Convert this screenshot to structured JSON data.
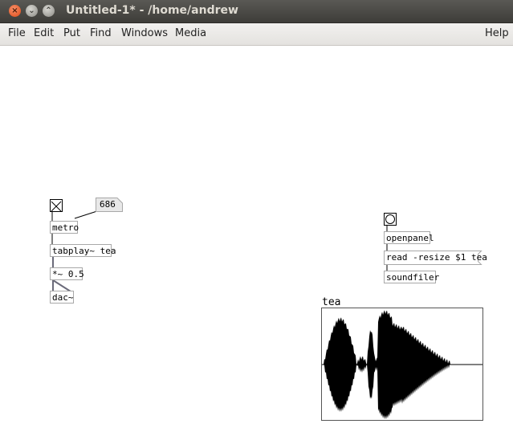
{
  "window": {
    "title": "Untitled-1* - /home/andrew",
    "close_glyph": "×",
    "min_glyph": "⌄",
    "max_glyph": "⌃"
  },
  "menubar": {
    "items": [
      "File",
      "Edit",
      "Put",
      "Find",
      "Windows",
      "Media"
    ],
    "help": "Help"
  },
  "patch": {
    "number_box_value": "686",
    "metro_label": "metro",
    "tabplay_label": "tabplay~ tea",
    "multiply_label": "*~ 0.5",
    "dac_label": "dac~",
    "openpanel_label": "openpanel",
    "read_message": "read -resize $1 tea",
    "soundfiler_label": "soundfiler",
    "array_name": "tea"
  },
  "colors": {
    "titlebar": "#3e3d39",
    "title_text": "#dfdbd2",
    "close_button": "#df4a16",
    "wire_signal": "#6b6b7a",
    "waveform": "#000000"
  }
}
